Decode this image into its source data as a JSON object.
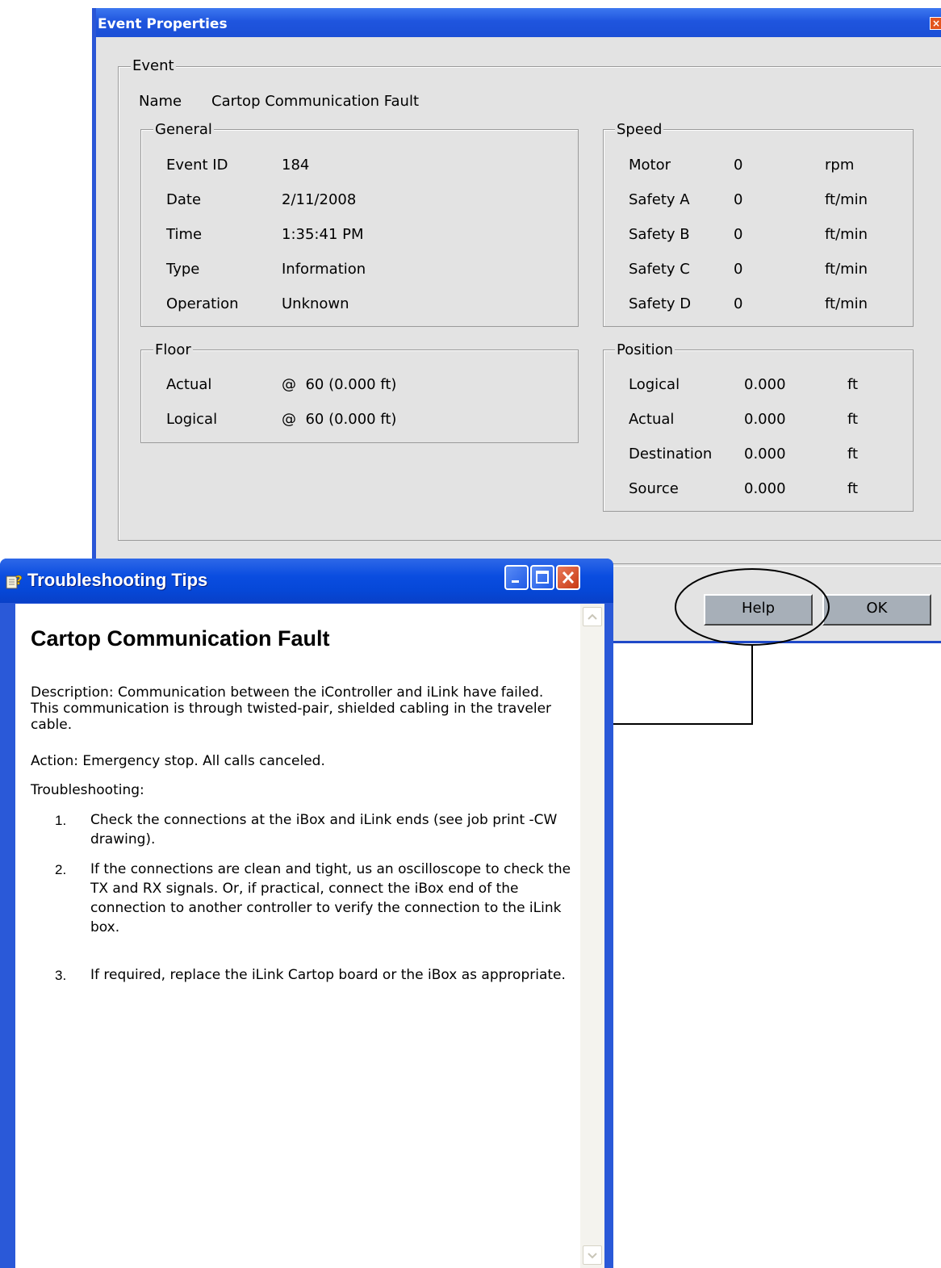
{
  "event_dialog": {
    "title": "Event Properties",
    "close_glyph": "×",
    "event_group": "Event",
    "name_label": "Name",
    "name_value": "Cartop Communication Fault",
    "general": {
      "legend": "General",
      "rows": [
        {
          "label": "Event ID",
          "value": "184"
        },
        {
          "label": "Date",
          "value": "2/11/2008"
        },
        {
          "label": "Time",
          "value": "1:35:41 PM"
        },
        {
          "label": "Type",
          "value": "Information"
        },
        {
          "label": "Operation",
          "value": "Unknown"
        }
      ]
    },
    "speed": {
      "legend": "Speed",
      "rows": [
        {
          "label": "Motor",
          "value": "0",
          "unit": "rpm"
        },
        {
          "label": "Safety A",
          "value": "0",
          "unit": "ft/min"
        },
        {
          "label": "Safety B",
          "value": "0",
          "unit": "ft/min"
        },
        {
          "label": "Safety C",
          "value": "0",
          "unit": "ft/min"
        },
        {
          "label": "Safety D",
          "value": "0",
          "unit": "ft/min"
        }
      ]
    },
    "floor": {
      "legend": "Floor",
      "rows": [
        {
          "label": "Actual",
          "value": "@  60 (0.000 ft)"
        },
        {
          "label": "Logical",
          "value": "@  60 (0.000 ft)"
        }
      ]
    },
    "position": {
      "legend": "Position",
      "rows": [
        {
          "label": "Logical",
          "value": "0.000",
          "unit": "ft"
        },
        {
          "label": "Actual",
          "value": "0.000",
          "unit": "ft"
        },
        {
          "label": "Destination",
          "value": "0.000",
          "unit": "ft"
        },
        {
          "label": "Source",
          "value": "0.000",
          "unit": "ft"
        }
      ]
    },
    "help_button": "Help",
    "ok_button": "OK"
  },
  "tips_window": {
    "title": "Troubleshooting Tips",
    "heading": "Cartop Communication Fault",
    "description": "Description: Communication between the iController and iLink have failed. This communication is through twisted-pair, shielded cabling in the traveler cable.",
    "action": "Action: Emergency stop. All calls canceled.",
    "troubleshooting_label": "Troubleshooting:",
    "steps": [
      {
        "num": "1.",
        "text": "Check the connections at the iBox and iLink ends (see job print -CW drawing)."
      },
      {
        "num": "2.",
        "text": "If the connections are clean and tight, us an oscilloscope to check the TX and RX signals. Or, if practical, connect the iBox end of the connection to another controller to verify the connection to the iLink box."
      },
      {
        "num": "3.",
        "text": "If required, replace the iLink Cartop board or the iBox as appropriate."
      }
    ]
  },
  "colors": {
    "titlebar_blue": "#1f55de",
    "dialog_gray": "#e3e3e3",
    "button_gray": "#a7afb8",
    "close_red": "#e2541e"
  }
}
